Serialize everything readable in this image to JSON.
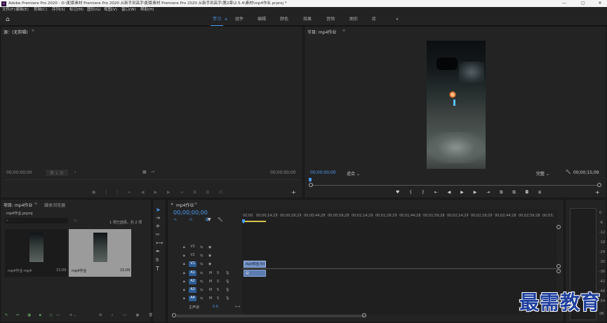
{
  "window": {
    "title": "Adobe Premiere Pro 2020 - D:\\配套素材 Premiere Pro 2020 从新手到高手\\配套素材 Premiere Pro 2020 从新手到高手\\第2章\\2.5.4\\素材\\mp4作业.prproj *",
    "logo": "Pr",
    "min": "—",
    "max": "▢",
    "close": "✕"
  },
  "menu": [
    "文件(F)",
    "编辑(E)",
    "剪辑(C)",
    "序列(S)",
    "标记(M)",
    "图形(G)",
    "视图(V)",
    "窗口(W)",
    "帮助(H)"
  ],
  "workspaces": {
    "tabs": [
      "学习",
      "组件",
      "编辑",
      "颜色",
      "效果",
      "音频",
      "图形",
      "库"
    ],
    "active": "学习",
    "overflow": "»"
  },
  "source": {
    "title": "源：(无剪辑)",
    "tc_left": "00;00;00;00",
    "tc_right": "00;00;00;00",
    "page": "第 1 页"
  },
  "program": {
    "title": "节目: mp4作业",
    "tc": "00;00;00;00",
    "fit": "适合",
    "quality": "完整",
    "duration": "00;00;15;09"
  },
  "project": {
    "tabs": [
      "项目: mp4作业",
      "媒体浏览器"
    ],
    "file": "mp4作业.prproj",
    "selection": "1 项已选择，共 2 项",
    "items": [
      {
        "name": "mp4作业.mp4",
        "dur": "15;09"
      },
      {
        "name": "mp4作业",
        "dur": "15;09"
      }
    ]
  },
  "timeline": {
    "title": "mp4作业",
    "tc": "00;00;00;00",
    "ruler": [
      "00;00",
      "00;00;14;29",
      "00;00;29;29",
      "00;00;44;28",
      "00;00;59;28",
      "00;01;14;29",
      "00;01;29;29",
      "00;01;44;28",
      "00;01;59;28",
      "00;02;14;29",
      "00;02;29;29",
      "00;02;44;28",
      "00;02;59;28",
      "00;03;"
    ],
    "video_tracks": [
      "V3",
      "V2",
      "V1"
    ],
    "audio_tracks": [
      "A1",
      "A2",
      "A3",
      "A4"
    ],
    "master": "主声道",
    "master_val": "0.0",
    "clip": "mp4作业 [V]",
    "m": "M",
    "s": "S"
  },
  "meter": {
    "scale": [
      "0",
      "-6",
      "-12",
      "-18",
      "-24",
      "-30",
      "-36",
      "-42",
      "-48",
      "-54",
      "dB"
    ]
  },
  "watermark": "最需教育",
  "icons": [
    "home-icon",
    "play-icon",
    "wrench-icon",
    "plus-icon",
    "camera-icon",
    "selection-tool-icon",
    "razor-tool-icon",
    "pen-tool-icon",
    "hand-tool-icon",
    "type-tool-icon",
    "eye-icon",
    "lock-icon",
    "mic-icon"
  ]
}
